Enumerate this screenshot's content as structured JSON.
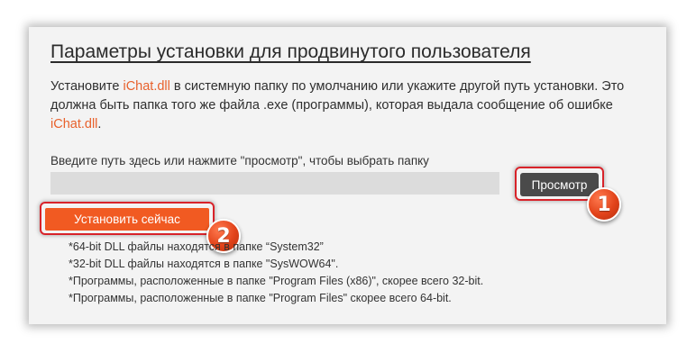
{
  "title": "Параметры установки для продвинутого пользователя",
  "description": {
    "part1": "Установите ",
    "dll1": "iChat.dll",
    "part2": " в системную папку по умолчанию или укажите другой путь установки. Это должна быть папка того же файла .exe (программы), которая выдала сообщение об ошибке ",
    "dll2": "iChat.dll",
    "part3": "."
  },
  "path_label": "Введите путь здесь или нажмите \"просмотр\", чтобы выбрать папку",
  "path_input": {
    "value": "",
    "placeholder": ""
  },
  "browse_button": "Просмотр",
  "install_button": "Установить сейчас",
  "badges": [
    "1",
    "2"
  ],
  "notes": [
    "*64-bit DLL файлы находятся в папке “System32”",
    "*32-bit DLL файлы находятся в папке \"SysWOW64\".",
    "*Программы, расположенные в папке \"Program Files (x86)\", скорее всего 32-bit.",
    "*Программы, расположенные в папке \"Program Files\" скорее всего 64-bit."
  ],
  "colors": {
    "accent": "#f15a22",
    "link": "#e8612c",
    "browse_bg": "#4a4a4a",
    "highlight_frame": "#d8232a",
    "panel_bg": "#f3f3f3"
  }
}
